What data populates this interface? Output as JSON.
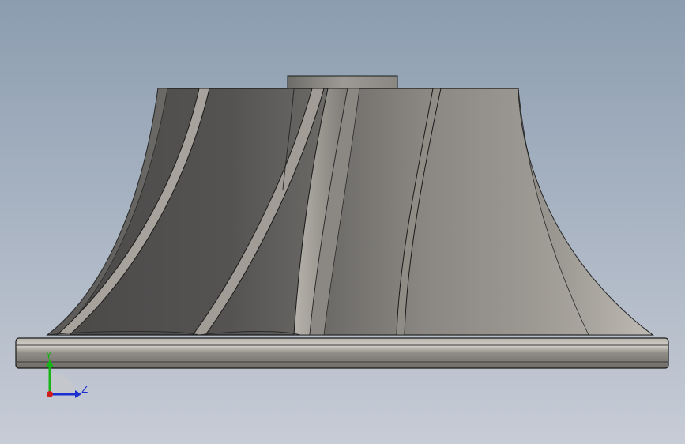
{
  "viewport": {
    "background_top": "#8c9db0",
    "background_bottom": "#c7ccd6",
    "model": "impeller"
  },
  "part_colors": {
    "edge": "#1a1a1a",
    "base_light": "#c9c6c0",
    "base_dark": "#7a7772",
    "blade_dark": "#545251",
    "blade_mid": "#6f6c68",
    "blade_light": "#a39f99",
    "hub_face": "#9a978f"
  },
  "triad": {
    "y_label": "Y",
    "z_label": "Z",
    "y_color": "#17b417",
    "z_color": "#1a2fcf",
    "x_color": "#d01c1c"
  }
}
